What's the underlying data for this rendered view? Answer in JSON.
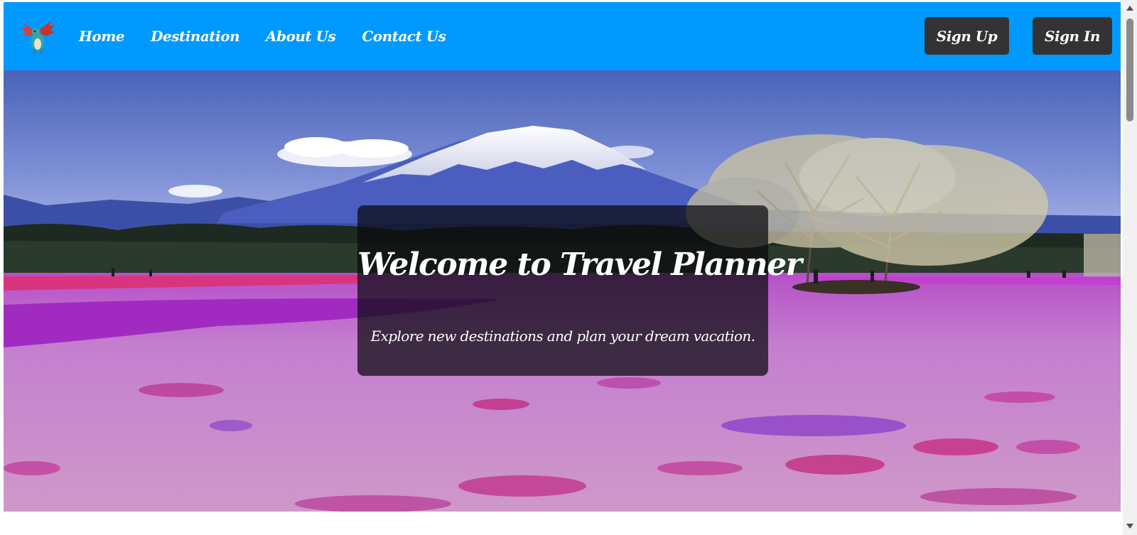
{
  "nav": {
    "links": {
      "home": "Home",
      "destination": "Destination",
      "about": "About Us",
      "contact": "Contact Us"
    },
    "sign_up_label": "Sign Up",
    "sign_in_label": "Sign In"
  },
  "hero": {
    "title": "Welcome to Travel Planner",
    "subtitle": "Explore new destinations and plan your dream vacation."
  },
  "colors": {
    "nav_background": "#0099ff",
    "button_background": "#333333",
    "overlay_background": "rgba(10,10,14,0.72)"
  },
  "icons": {
    "logo": "dragon-logo-icon"
  }
}
